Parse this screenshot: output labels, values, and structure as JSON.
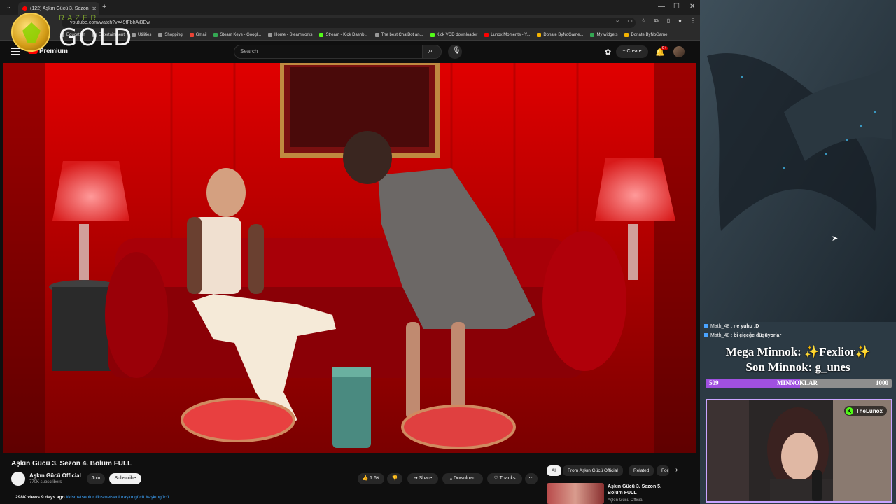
{
  "browser": {
    "tab_title": "(122) Aşkın Gücü 3. Sezon",
    "url": "youtube.com/watch?v=49fFbhAiBEw",
    "bookmarks": [
      "Education",
      "Entertainment",
      "Utilities",
      "Shopping",
      "Gmail",
      "Steam Keys - Googl...",
      "Home - Steamworks",
      "Stream - Kick Dashb...",
      "The best ChatBot an...",
      "Kick VOD downloader",
      "Lunox Moments - Y...",
      "Donate ByNoGame...",
      "My widgets",
      "Donate ByNoGame"
    ]
  },
  "razer": {
    "brand": "RAZER",
    "tier": "GOLD"
  },
  "youtube": {
    "logo": "Premium",
    "search_placeholder": "Search",
    "create": "Create",
    "notif_badge": "9+",
    "video_title": "Aşkın Gücü 3. Sezon 4. Bölüm FULL",
    "channel": "Aşkın Gücü Official",
    "subs": "770K subscribers",
    "join": "Join",
    "subscribe": "Subscribe",
    "likes": "1.6K",
    "share": "Share",
    "download": "Download",
    "thanks": "Thanks",
    "views": "298K views",
    "age": "9 days ago",
    "tags": "#kismetseolur #kısmetseoluraşkıngücü #aşkıngücü",
    "chips": [
      "All",
      "From Aşkın Gücü Official",
      "Related",
      "For"
    ],
    "rec_title": "Aşkın Gücü 3. Sezon 5. Bölüm FULL",
    "rec_channel": "Aşkın Gücü Official"
  },
  "stream": {
    "chat": [
      {
        "user": "Math_48",
        "msg": "ne yuhu :D"
      },
      {
        "user": "Math_48",
        "msg": "bi çiçeğe düşüyorlar"
      }
    ],
    "mega_line": "Mega Minnok: ✨Fexlior✨",
    "son_line": "Son Minnok: g_unes",
    "goal_current": "509",
    "goal_label": "MINNOKLAR",
    "goal_target": "1000",
    "goal_fraction": 0.509,
    "kick_name": "TheLunox"
  }
}
